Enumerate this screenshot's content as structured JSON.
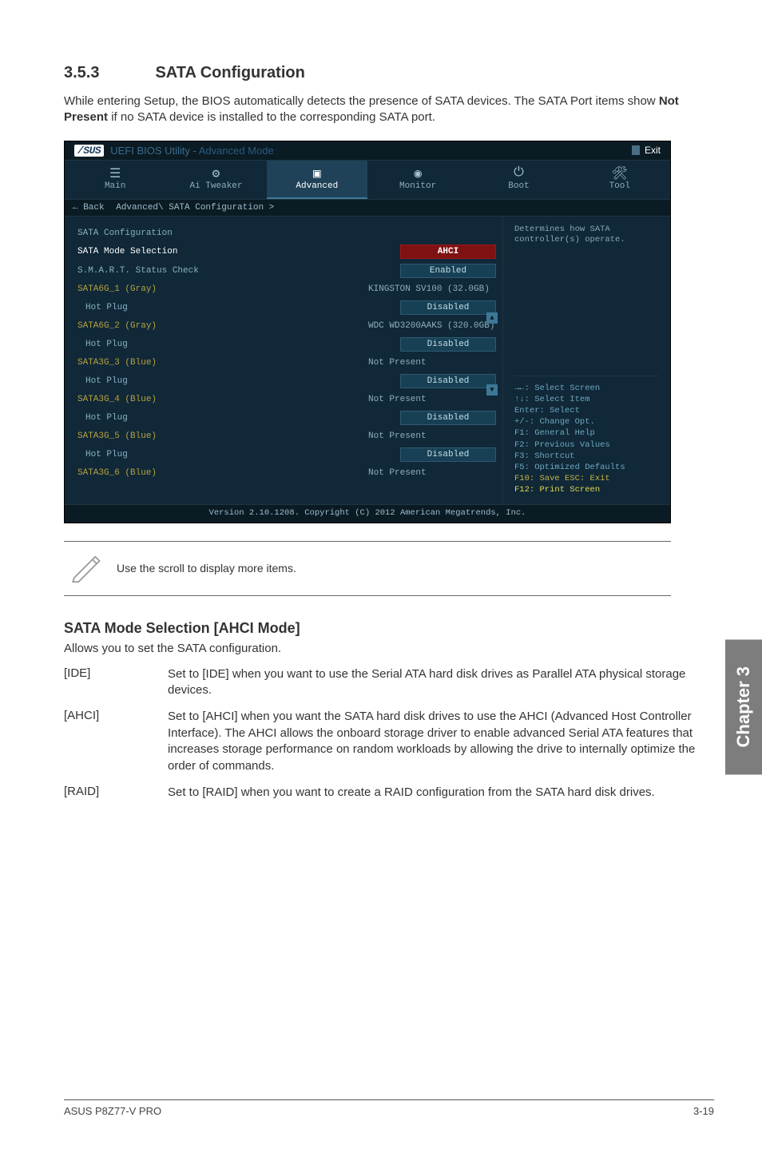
{
  "section": {
    "number": "3.5.3",
    "title": "SATA Configuration"
  },
  "intro": {
    "prefix": "While entering Setup, the BIOS automatically detects the presence of SATA devices. The SATA Port items show ",
    "bold": "Not Present",
    "suffix": " if no SATA device is installed to the corresponding SATA port."
  },
  "bios": {
    "brand": "/SUS",
    "title_plain": "UEFI BIOS Utility - ",
    "title_mode": "Advanced Mode",
    "exit": "Exit",
    "tabs": [
      {
        "label": "Main"
      },
      {
        "label": "Ai Tweaker"
      },
      {
        "label": "Advanced"
      },
      {
        "label": "Monitor"
      },
      {
        "label": "Boot"
      },
      {
        "label": "Tool"
      }
    ],
    "breadcrumb_back": "← Back",
    "breadcrumb_path": "Advanced\\ SATA Configuration >",
    "rows": [
      {
        "label": "SATA Configuration",
        "value": "",
        "type": "header"
      },
      {
        "label": "SATA Mode Selection",
        "value": "AHCI",
        "type": "ahci",
        "highlight": true
      },
      {
        "label": "S.M.A.R.T. Status Check",
        "value": "Enabled",
        "type": "framed"
      },
      {
        "label": "SATA6G_1 (Gray)",
        "value": "KINGSTON SV100 (32.0GB)",
        "type": "plain",
        "sata": true
      },
      {
        "label": "Hot Plug",
        "value": "Disabled",
        "type": "framed",
        "indent": true
      },
      {
        "label": "SATA6G_2 (Gray)",
        "value": "WDC WD3200AAKS (320.0GB)",
        "type": "plain",
        "sata": true
      },
      {
        "label": "Hot Plug",
        "value": "Disabled",
        "type": "framed",
        "indent": true
      },
      {
        "label": "SATA3G_3 (Blue)",
        "value": "Not Present",
        "type": "plain",
        "sata": true
      },
      {
        "label": "Hot Plug",
        "value": "Disabled",
        "type": "framed",
        "indent": true
      },
      {
        "label": "SATA3G_4 (Blue)",
        "value": "Not Present",
        "type": "plain",
        "sata": true
      },
      {
        "label": "Hot Plug",
        "value": "Disabled",
        "type": "framed",
        "indent": true
      },
      {
        "label": "SATA3G_5 (Blue)",
        "value": "Not Present",
        "type": "plain",
        "sata": true
      },
      {
        "label": "Hot Plug",
        "value": "Disabled",
        "type": "framed",
        "indent": true
      },
      {
        "label": "SATA3G_6 (Blue)",
        "value": "Not Present",
        "type": "plain",
        "sata": true
      }
    ],
    "help_top": "Determines how SATA controller(s) operate.",
    "help_keys": [
      {
        "cls": "fk",
        "text": "→←: Select Screen"
      },
      {
        "cls": "fk",
        "text": "↑↓: Select Item"
      },
      {
        "cls": "fk",
        "text": "Enter: Select"
      },
      {
        "cls": "fk",
        "text": "+/-: Change Opt."
      },
      {
        "cls": "fk",
        "text": "F1: General Help"
      },
      {
        "cls": "fk",
        "text": "F2: Previous Values"
      },
      {
        "cls": "fk",
        "text": "F3: Shortcut"
      },
      {
        "cls": "fk",
        "text": "F5: Optimized Defaults"
      },
      {
        "cls": "f10",
        "text": "F10: Save  ESC: Exit"
      },
      {
        "cls": "f12",
        "text": "F12: Print Screen"
      }
    ],
    "footer": "Version 2.10.1208. Copyright (C) 2012 American Megatrends, Inc."
  },
  "note": "Use the scroll to display more items.",
  "mode_section": {
    "heading": "SATA Mode Selection [AHCI Mode]",
    "desc": "Allows you to set the SATA configuration.",
    "options": [
      {
        "key": "[IDE]",
        "desc": "Set to [IDE] when you want to use the Serial ATA hard disk drives as Parallel ATA physical storage devices."
      },
      {
        "key": "[AHCI]",
        "desc": "Set to [AHCI] when you want the SATA hard disk drives to use the AHCI (Advanced Host Controller Interface). The AHCI allows the onboard storage driver to enable advanced Serial ATA features that increases storage performance on random workloads by allowing the drive to internally optimize the order of commands."
      },
      {
        "key": "[RAID]",
        "desc": "Set to [RAID] when you want to create a RAID configuration from the SATA hard disk drives."
      }
    ]
  },
  "chapter_tab": "Chapter 3",
  "footer": {
    "left": "ASUS P8Z77-V PRO",
    "right": "3-19"
  }
}
